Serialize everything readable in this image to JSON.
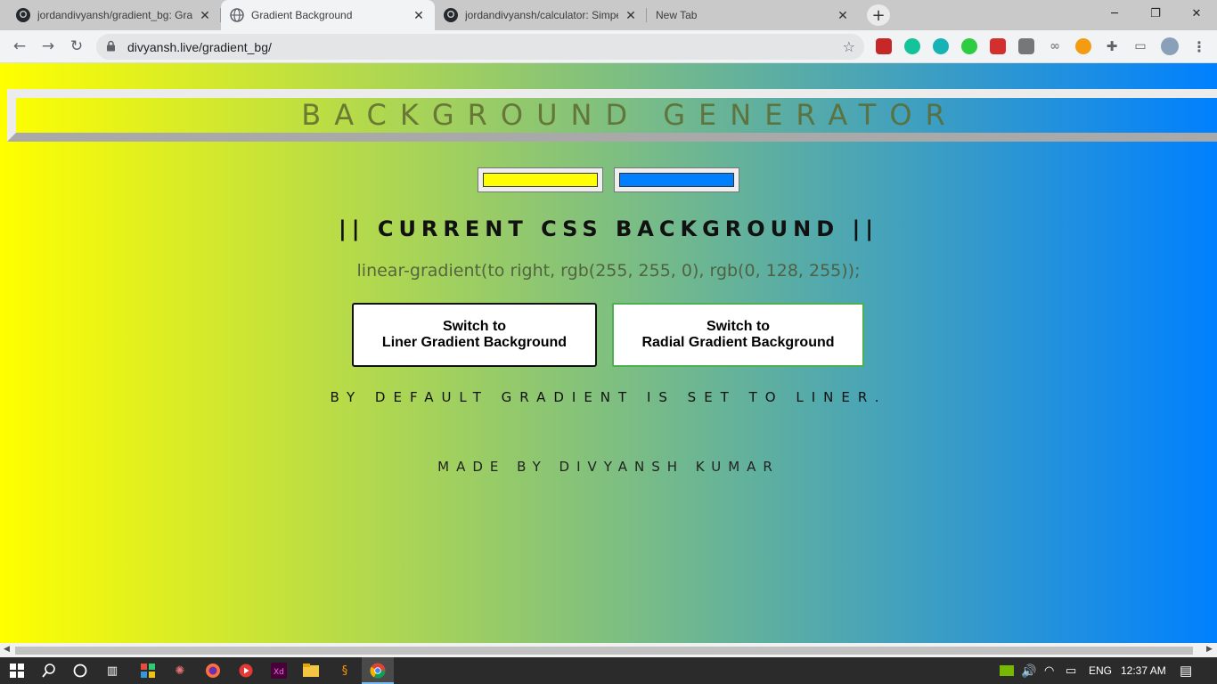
{
  "browser": {
    "tabs": [
      {
        "title": "jordandivyansh/gradient_bg: Gra",
        "icon": "github-icon",
        "active": false
      },
      {
        "title": "Gradient Background",
        "icon": "globe-icon",
        "active": true
      },
      {
        "title": "jordandivyansh/calculator: Simpe",
        "icon": "github-icon",
        "active": false
      },
      {
        "title": "New Tab",
        "icon": "",
        "active": false
      }
    ],
    "url": "divyansh.live/gradient_bg/",
    "tab_close_glyph": "✕",
    "new_tab_glyph": "+",
    "minimize_glyph": "─",
    "restore_glyph": "❐",
    "close_glyph": "✕"
  },
  "page": {
    "heading": "BACKGROUND GENERATOR",
    "color1": "#ffff00",
    "color2": "#0080ff",
    "current_title": "|| CURRENT CSS BACKGROUND ||",
    "css_text": "linear-gradient(to right, rgb(255, 255, 0), rgb(0, 128, 255));",
    "linear_button": "Switch to\nLiner Gradient Background",
    "radial_button": "Switch to\nRadial Gradient Background",
    "default_note": "BY DEFAULT GRADIENT IS SET TO LINER.",
    "credit": "MADE BY DIVYANSH KUMAR"
  },
  "taskbar": {
    "language": "ENG",
    "time": "12:37 AM"
  }
}
